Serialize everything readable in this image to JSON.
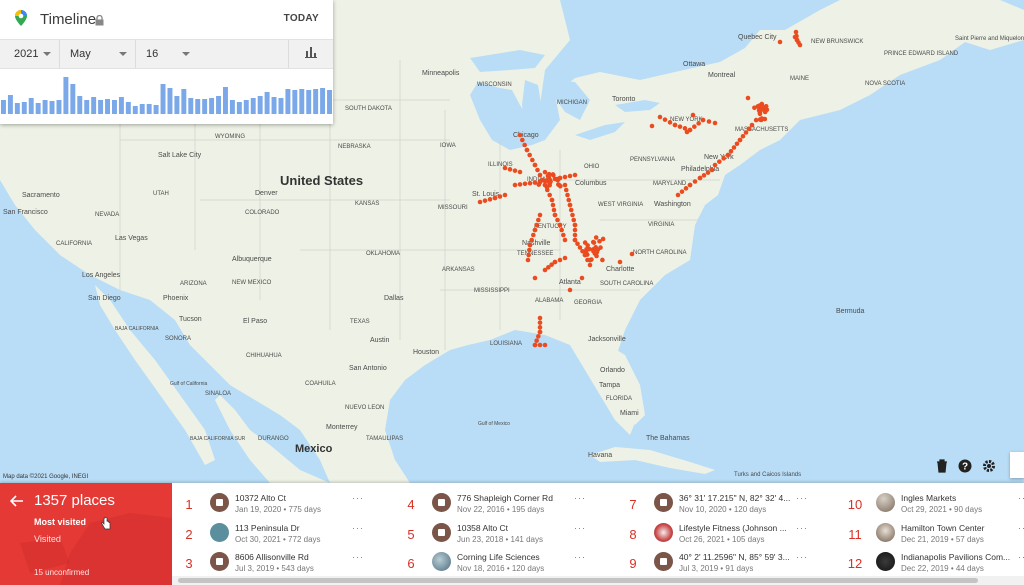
{
  "timeline": {
    "title": "Timeline",
    "today_label": "TODAY",
    "year": "2021",
    "month": "May",
    "day": "16",
    "icons": [
      "maps-pin-icon",
      "lock-icon",
      "bar-chart-icon"
    ]
  },
  "map": {
    "country_label": "United States",
    "mexico_label": "Mexico",
    "attribution": "Map data ©2021 Google, INEGI",
    "cities": [
      {
        "id": "quebec",
        "label": "Quebec City"
      },
      {
        "id": "ottawa",
        "label": "Ottawa"
      },
      {
        "id": "montreal",
        "label": "Montreal"
      },
      {
        "id": "toronto",
        "label": "Toronto"
      },
      {
        "id": "minneapolis",
        "label": "Minneapolis"
      },
      {
        "id": "wisconsin",
        "label": "WISCONSIN"
      },
      {
        "id": "michigan",
        "label": "MICHIGAN"
      },
      {
        "id": "chicago",
        "label": "Chicago"
      },
      {
        "id": "maine",
        "label": "MAINE"
      },
      {
        "id": "newbrunswick",
        "label": "NEW BRUNSWICK"
      },
      {
        "id": "pei",
        "label": "PRINCE EDWARD ISLAND"
      },
      {
        "id": "saintpierre",
        "label": "Saint Pierre and Miquelon"
      },
      {
        "id": "novascotia",
        "label": "NOVA SCOTIA"
      },
      {
        "id": "newyork",
        "label": "NEW YORK"
      },
      {
        "id": "massachusetts",
        "label": "MASSACHUSETTS"
      },
      {
        "id": "newyorkcity",
        "label": "New York"
      },
      {
        "id": "pennsylvania",
        "label": "PENNSYLVANIA"
      },
      {
        "id": "philadelphia",
        "label": "Philadelphia"
      },
      {
        "id": "maryland",
        "label": "MARYLAND"
      },
      {
        "id": "washington",
        "label": "Washington"
      },
      {
        "id": "ohio",
        "label": "OHIO"
      },
      {
        "id": "columbus",
        "label": "Columbus"
      },
      {
        "id": "indiana",
        "label": "INDIANA"
      },
      {
        "id": "stlouis",
        "label": "St. Louis"
      },
      {
        "id": "missouri",
        "label": "MISSOURI"
      },
      {
        "id": "kansas",
        "label": "KANSAS"
      },
      {
        "id": "nebraska",
        "label": "NEBRASKA"
      },
      {
        "id": "iowa",
        "label": "IOWA"
      },
      {
        "id": "illinois",
        "label": "ILLINOIS"
      },
      {
        "id": "kentucky",
        "label": "KENTUCKY"
      },
      {
        "id": "virginia",
        "label": "VIRGINIA"
      },
      {
        "id": "westvirginia",
        "label": "WEST VIRGINIA"
      },
      {
        "id": "nashville",
        "label": "Nashville"
      },
      {
        "id": "tennessee",
        "label": "TENNESSEE"
      },
      {
        "id": "charlotte",
        "label": "Charlotte"
      },
      {
        "id": "northcarolina",
        "label": "NORTH CAROLINA"
      },
      {
        "id": "southcarolina",
        "label": "SOUTH CAROLINA"
      },
      {
        "id": "atlanta",
        "label": "Atlanta"
      },
      {
        "id": "georgia",
        "label": "GEORGIA"
      },
      {
        "id": "alabama",
        "label": "ALABAMA"
      },
      {
        "id": "mississippi",
        "label": "MISSISSIPPI"
      },
      {
        "id": "arkansas",
        "label": "ARKANSAS"
      },
      {
        "id": "oklahoma",
        "label": "OKLAHOMA"
      },
      {
        "id": "dallas",
        "label": "Dallas"
      },
      {
        "id": "texas",
        "label": "TEXAS"
      },
      {
        "id": "austin",
        "label": "Austin"
      },
      {
        "id": "houston",
        "label": "Houston"
      },
      {
        "id": "sanantonio",
        "label": "San Antonio"
      },
      {
        "id": "louisiana",
        "label": "LOUISIANA"
      },
      {
        "id": "jacksonville",
        "label": "Jacksonville"
      },
      {
        "id": "orlando",
        "label": "Orlando"
      },
      {
        "id": "tampa",
        "label": "Tampa"
      },
      {
        "id": "florida",
        "label": "FLORIDA"
      },
      {
        "id": "miami",
        "label": "Miami"
      },
      {
        "id": "bermuda",
        "label": "Bermuda"
      },
      {
        "id": "thebahamas",
        "label": "The Bahamas"
      },
      {
        "id": "havana",
        "label": "Havana"
      },
      {
        "id": "turks",
        "label": "Turks and Caicos Islands"
      },
      {
        "id": "monterrey",
        "label": "Monterrey"
      },
      {
        "id": "coahuila",
        "label": "COAHUILA"
      },
      {
        "id": "nuevoleon",
        "label": "NUEVO LEON"
      },
      {
        "id": "tamaulipas",
        "label": "TAMAULIPAS"
      },
      {
        "id": "durango",
        "label": "DURANGO"
      },
      {
        "id": "chihuahua",
        "label": "CHIHUAHUA"
      },
      {
        "id": "sonora",
        "label": "SONORA"
      },
      {
        "id": "sinaloa",
        "label": "SINALOA"
      },
      {
        "id": "gulfofmexico",
        "label": "Gulf of Mexico"
      },
      {
        "id": "gulfofcalifornia",
        "label": "Gulf of California"
      },
      {
        "id": "elpaso",
        "label": "El Paso"
      },
      {
        "id": "tucson",
        "label": "Tucson"
      },
      {
        "id": "phoenix",
        "label": "Phoenix"
      },
      {
        "id": "arizona",
        "label": "ARIZONA"
      },
      {
        "id": "newmexico",
        "label": "NEW MEXICO"
      },
      {
        "id": "albuquerque",
        "label": "Albuquerque"
      },
      {
        "id": "sandiego",
        "label": "San Diego"
      },
      {
        "id": "losangeles",
        "label": "Los Angeles"
      },
      {
        "id": "lasvegas",
        "label": "Las Vegas"
      },
      {
        "id": "nevada",
        "label": "NEVADA"
      },
      {
        "id": "california",
        "label": "CALIFORNIA"
      },
      {
        "id": "sanfrancisco",
        "label": "San Francisco"
      },
      {
        "id": "sacramento",
        "label": "Sacramento"
      },
      {
        "id": "utah",
        "label": "UTAH"
      },
      {
        "id": "saltlakecity",
        "label": "Salt Lake City"
      },
      {
        "id": "colorado",
        "label": "COLORADO"
      },
      {
        "id": "denver",
        "label": "Denver"
      },
      {
        "id": "wyoming",
        "label": "WYOMING"
      },
      {
        "id": "southdakota",
        "label": "SOUTH DAKOTA"
      },
      {
        "id": "bajacalifornia",
        "label": "BAJA CALIFORNIA"
      },
      {
        "id": "bajacaliforniasur",
        "label": "BAJA CALIFORNIA SUR"
      }
    ],
    "controls": [
      "trash-icon",
      "help-icon",
      "settings-icon"
    ]
  },
  "places_card": {
    "count": "1357 places",
    "most_visited": "Most visited",
    "visited": "Visited",
    "unconfirmed": "15 unconfirmed"
  },
  "places": [
    {
      "rank": "1",
      "name": "10372 Alto Ct",
      "meta": "Jan 19, 2020 • 775 days",
      "icon": "stop-icon"
    },
    {
      "rank": "2",
      "name": "113 Peninsula Dr",
      "meta": "Oct 30, 2021 • 772 days",
      "icon": "home-icon"
    },
    {
      "rank": "3",
      "name": "8606 Allisonville Rd",
      "meta": "Jul 3, 2019 • 543 days",
      "icon": "stop-icon"
    },
    {
      "rank": "4",
      "name": "776 Shapleigh Corner Rd",
      "meta": "Nov 22, 2016 • 195 days",
      "icon": "stop-icon"
    },
    {
      "rank": "5",
      "name": "10358 Alto Ct",
      "meta": "Jun 23, 2018 • 141 days",
      "icon": "stop-icon"
    },
    {
      "rank": "6",
      "name": "Corning Life Sciences",
      "meta": "Nov 18, 2016 • 120 days",
      "icon": "place-photo-icon"
    },
    {
      "rank": "7",
      "name": "36° 31' 17.215\" N, 82° 32' 4...",
      "meta": "Nov 10, 2020 • 120 days",
      "icon": "stop-icon"
    },
    {
      "rank": "8",
      "name": "Lifestyle Fitness (Johnson ...",
      "meta": "Oct 26, 2021 • 105 days",
      "icon": "place-photo-icon"
    },
    {
      "rank": "9",
      "name": "40° 2' 11.2596\" N, 85° 59' 3...",
      "meta": "Jul 3, 2019 • 91 days",
      "icon": "stop-icon"
    },
    {
      "rank": "10",
      "name": "Ingles Markets",
      "meta": "Oct 29, 2021 • 90 days",
      "icon": "place-photo-icon"
    },
    {
      "rank": "11",
      "name": "Hamilton Town Center",
      "meta": "Dec 21, 2019 • 57 days",
      "icon": "place-photo-icon"
    },
    {
      "rank": "12",
      "name": "Indianapolis Pavilions Com...",
      "meta": "Dec 22, 2019 • 44 days",
      "icon": "place-photo-icon"
    }
  ],
  "more_label": "···",
  "colors": {
    "accent": "#e53935",
    "dot": "#ea4b1f",
    "bars": "#7aa8e8",
    "water": "#b9ddf6",
    "land": "#eef2e6"
  }
}
